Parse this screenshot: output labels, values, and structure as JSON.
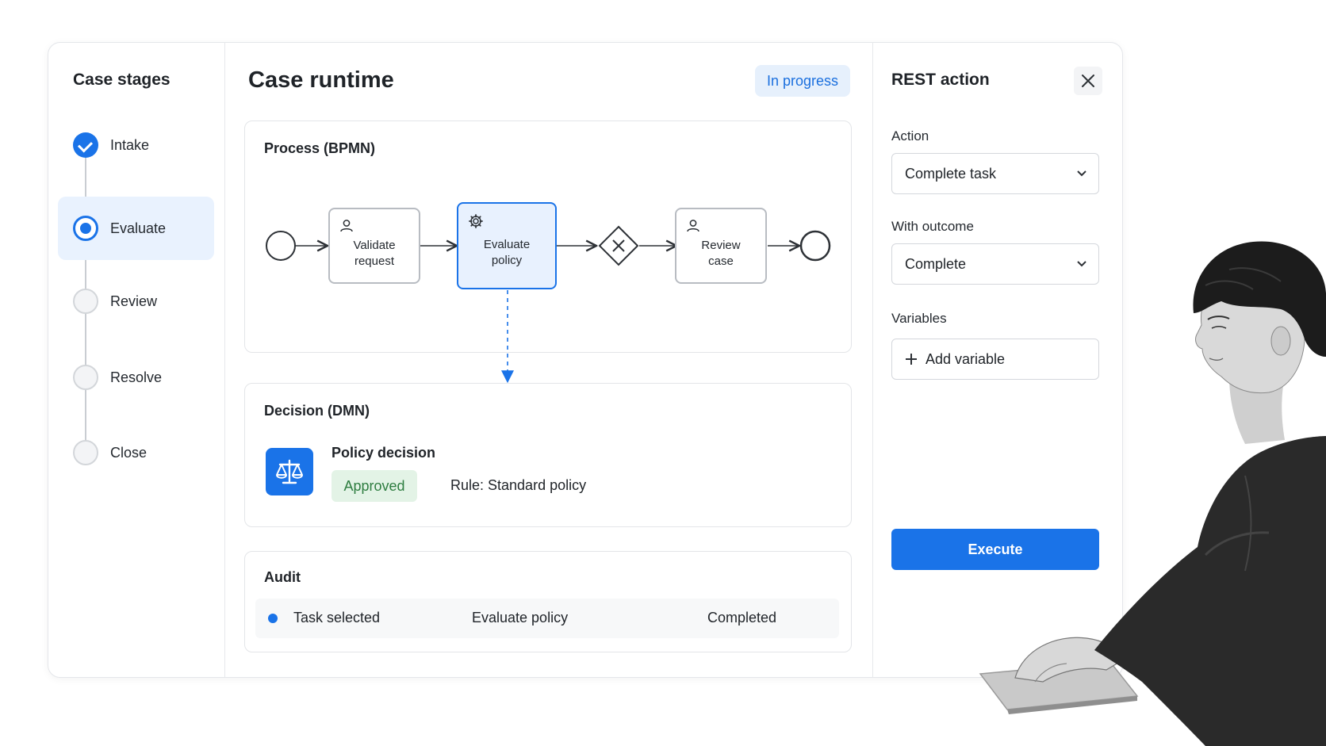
{
  "sidebar": {
    "title": "Case stages",
    "stages": [
      {
        "label": "Intake",
        "state": "done"
      },
      {
        "label": "Evaluate",
        "state": "current"
      },
      {
        "label": "Review",
        "state": "todo"
      },
      {
        "label": "Resolve",
        "state": "todo"
      },
      {
        "label": "Close",
        "state": "todo"
      }
    ]
  },
  "main": {
    "title": "Case runtime",
    "status": "In progress",
    "process": {
      "title": "Process (BPMN)",
      "tasks": [
        {
          "label": "Validate\nrequest",
          "icon": "user-icon"
        },
        {
          "label": "Evaluate\npolicy",
          "icon": "gear-icon"
        },
        {
          "label": "Review\ncase",
          "icon": "user-icon"
        }
      ]
    },
    "decision": {
      "title": "Decision (DMN)",
      "icon": "scale-icon",
      "name": "Policy decision",
      "result": "Approved",
      "rule": "Rule: Standard policy"
    },
    "audit": {
      "title": "Audit",
      "rows": [
        {
          "event": "Task selected",
          "task": "Evaluate policy",
          "status": "Completed"
        }
      ]
    }
  },
  "rest_panel": {
    "title": "REST action",
    "action_label": "Action",
    "action_value": "Complete task",
    "outcome_label": "With outcome",
    "outcome_value": "Complete",
    "variables_label": "Variables",
    "add_variable": "Add variable",
    "execute": "Execute"
  },
  "colors": {
    "accent": "#1a73e8",
    "accent_light": "#e9f2fe",
    "approved_bg": "#e3f3e6",
    "approved_text": "#2e7d40"
  }
}
